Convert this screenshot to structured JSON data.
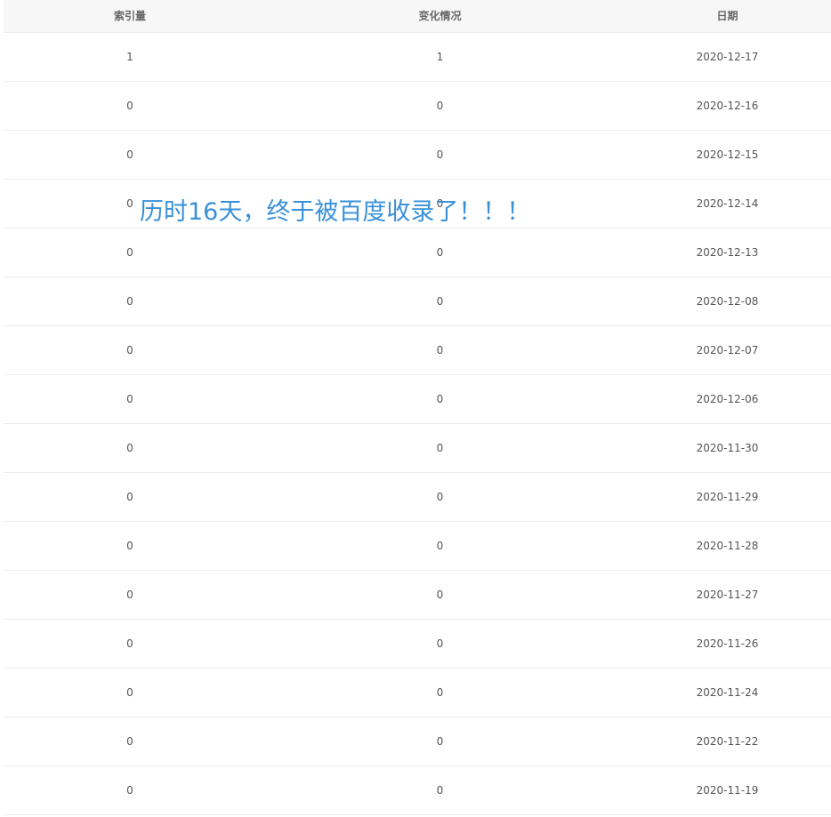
{
  "table": {
    "headers": [
      "索引量",
      "变化情况",
      "日期"
    ],
    "rows": [
      {
        "index": "1",
        "change": "1",
        "date": "2020-12-17"
      },
      {
        "index": "0",
        "change": "0",
        "date": "2020-12-16"
      },
      {
        "index": "0",
        "change": "0",
        "date": "2020-12-15"
      },
      {
        "index": "0",
        "change": "0",
        "date": "2020-12-14"
      },
      {
        "index": "0",
        "change": "0",
        "date": "2020-12-13"
      },
      {
        "index": "0",
        "change": "0",
        "date": "2020-12-08"
      },
      {
        "index": "0",
        "change": "0",
        "date": "2020-12-07"
      },
      {
        "index": "0",
        "change": "0",
        "date": "2020-12-06"
      },
      {
        "index": "0",
        "change": "0",
        "date": "2020-11-30"
      },
      {
        "index": "0",
        "change": "0",
        "date": "2020-11-29"
      },
      {
        "index": "0",
        "change": "0",
        "date": "2020-11-28"
      },
      {
        "index": "0",
        "change": "0",
        "date": "2020-11-27"
      },
      {
        "index": "0",
        "change": "0",
        "date": "2020-11-26"
      },
      {
        "index": "0",
        "change": "0",
        "date": "2020-11-24"
      },
      {
        "index": "0",
        "change": "0",
        "date": "2020-11-22"
      },
      {
        "index": "0",
        "change": "0",
        "date": "2020-11-19"
      }
    ]
  },
  "overlay": {
    "text": "历时16天，终于被百度收录了！！！",
    "color": "#3a90d8"
  }
}
